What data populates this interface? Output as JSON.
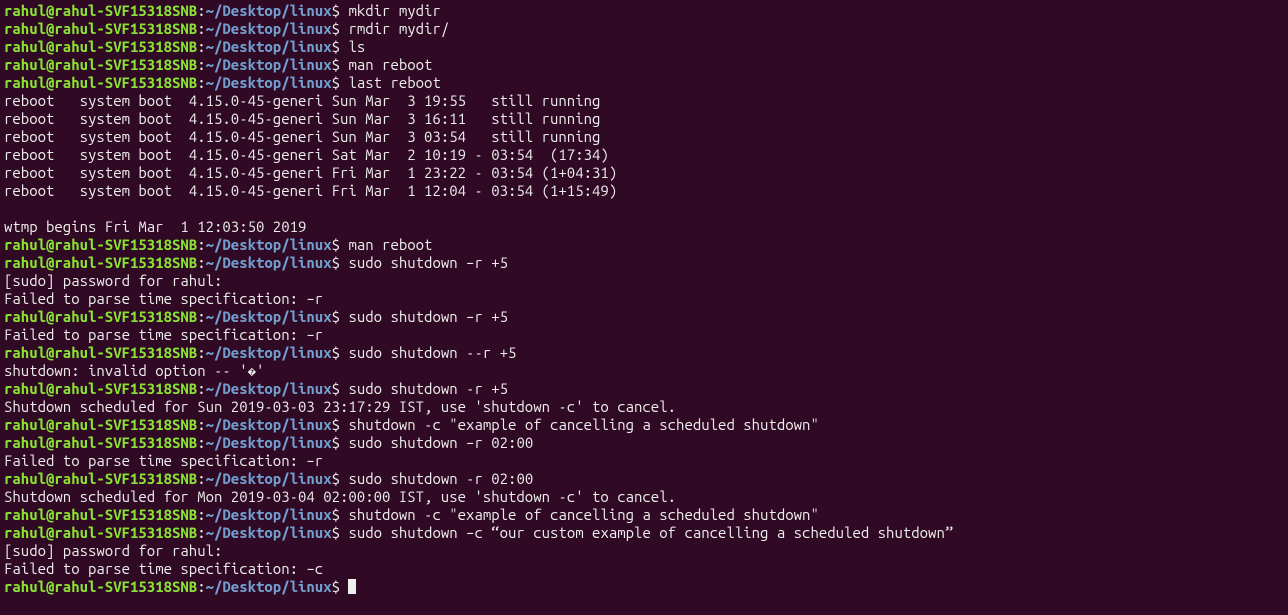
{
  "prompt": {
    "user": "rahul",
    "at": "@",
    "host": "rahul-SVF15318SNB",
    "colon": ":",
    "path": "~/Desktop/linux",
    "dollar": "$ "
  },
  "lines": [
    {
      "type": "prompt",
      "cmd": "mkdir mydir"
    },
    {
      "type": "prompt",
      "cmd": "rmdir mydir/"
    },
    {
      "type": "prompt",
      "cmd": "ls"
    },
    {
      "type": "prompt",
      "cmd": "man reboot"
    },
    {
      "type": "prompt",
      "cmd": "last reboot"
    },
    {
      "type": "out",
      "text": "reboot   system boot  4.15.0-45-generi Sun Mar  3 19:55   still running"
    },
    {
      "type": "out",
      "text": "reboot   system boot  4.15.0-45-generi Sun Mar  3 16:11   still running"
    },
    {
      "type": "out",
      "text": "reboot   system boot  4.15.0-45-generi Sun Mar  3 03:54   still running"
    },
    {
      "type": "out",
      "text": "reboot   system boot  4.15.0-45-generi Sat Mar  2 10:19 - 03:54  (17:34)"
    },
    {
      "type": "out",
      "text": "reboot   system boot  4.15.0-45-generi Fri Mar  1 23:22 - 03:54 (1+04:31)"
    },
    {
      "type": "out",
      "text": "reboot   system boot  4.15.0-45-generi Fri Mar  1 12:04 - 03:54 (1+15:49)"
    },
    {
      "type": "out",
      "text": ""
    },
    {
      "type": "out",
      "text": "wtmp begins Fri Mar  1 12:03:50 2019"
    },
    {
      "type": "prompt",
      "cmd": "man reboot"
    },
    {
      "type": "prompt",
      "cmd": "sudo shutdown –r +5"
    },
    {
      "type": "out",
      "text": "[sudo] password for rahul: "
    },
    {
      "type": "out",
      "text": "Failed to parse time specification: –r"
    },
    {
      "type": "prompt",
      "cmd": "sudo shutdown –r +5"
    },
    {
      "type": "out",
      "text": "Failed to parse time specification: –r"
    },
    {
      "type": "prompt",
      "cmd": "sudo shutdown --r +5"
    },
    {
      "type": "out",
      "text": "shutdown: invalid option -- '�'"
    },
    {
      "type": "prompt",
      "cmd": "sudo shutdown -r +5"
    },
    {
      "type": "out",
      "text": "Shutdown scheduled for Sun 2019-03-03 23:17:29 IST, use 'shutdown -c' to cancel."
    },
    {
      "type": "prompt",
      "cmd": "shutdown -c \"example of cancelling a scheduled shutdown\""
    },
    {
      "type": "prompt",
      "cmd": "sudo shutdown –r 02:00"
    },
    {
      "type": "out",
      "text": "Failed to parse time specification: –r"
    },
    {
      "type": "prompt",
      "cmd": "sudo shutdown -r 02:00"
    },
    {
      "type": "out",
      "text": "Shutdown scheduled for Mon 2019-03-04 02:00:00 IST, use 'shutdown -c' to cancel."
    },
    {
      "type": "prompt",
      "cmd": "shutdown -c \"example of cancelling a scheduled shutdown\""
    },
    {
      "type": "prompt",
      "cmd": "sudo shutdown –c “our custom example of cancelling a scheduled shutdown”"
    },
    {
      "type": "out",
      "text": "[sudo] password for rahul: "
    },
    {
      "type": "out",
      "text": "Failed to parse time specification: –c"
    },
    {
      "type": "prompt",
      "cmd": "",
      "cursor": true
    }
  ]
}
